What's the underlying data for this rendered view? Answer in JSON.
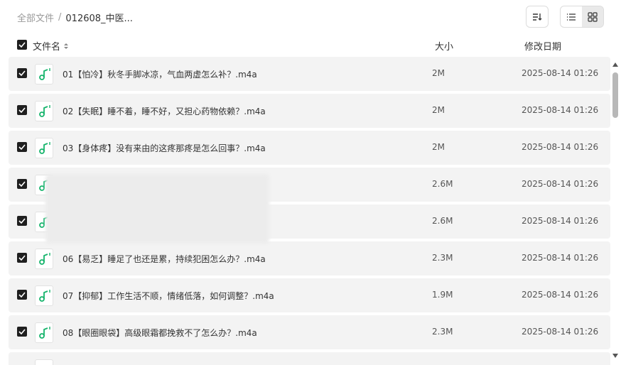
{
  "breadcrumb": {
    "root": "全部文件",
    "separator": "/",
    "current": "012608_中医..."
  },
  "columns": {
    "name": "文件名",
    "size": "大小",
    "modified": "修改日期"
  },
  "files": [
    {
      "name": "01【怕冷】秋冬手脚冰凉，气血两虚怎么补？.m4a",
      "size": "2M",
      "date": "2025-08-14 01:26"
    },
    {
      "name": "02【失眠】睡不着，睡不好，又担心药物依赖？.m4a",
      "size": "2M",
      "date": "2025-08-14 01:26"
    },
    {
      "name": "03【身体疼】没有来由的这疼那疼是怎么回事？.m4a",
      "size": "2M",
      "date": "2025-08-14 01:26"
    },
    {
      "name": "",
      "size": "2.6M",
      "date": "2025-08-14 01:26"
    },
    {
      "name": "",
      "size": "2.6M",
      "date": "2025-08-14 01:26"
    },
    {
      "name": "06【易乏】睡足了也还是累，持续犯困怎么办？.m4a",
      "size": "2.3M",
      "date": "2025-08-14 01:26"
    },
    {
      "name": "07【抑郁】工作生活不顺，情绪低落，如何调整？.m4a",
      "size": "1.9M",
      "date": "2025-08-14 01:26"
    },
    {
      "name": "08【眼圈眼袋】高级眼霜都挽救不了怎么办？.m4a",
      "size": "2.3M",
      "date": "2025-08-14 01:26"
    }
  ],
  "icons": {
    "file": "music-note-icon",
    "sort": "sort-icon",
    "list_view": "list-view-icon",
    "grid_view": "grid-view-icon"
  },
  "colors": {
    "accent": "#16b46c",
    "checkbox": "#1f1f1f",
    "row_bg": "#f3f3f3"
  }
}
